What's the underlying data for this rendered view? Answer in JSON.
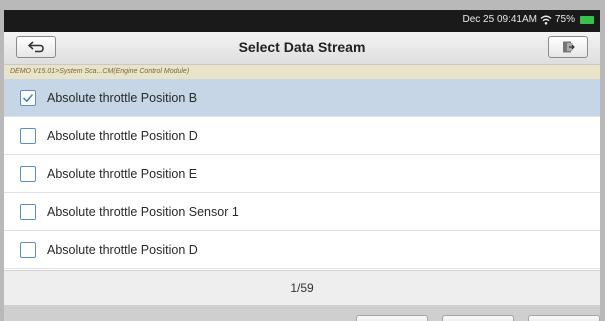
{
  "status_bar": {
    "datetime": "Dec 25 09:41AM",
    "battery": "75%",
    "wifi_icon": "wifi-icon",
    "battery_icon": "battery-icon",
    "battery_color": "#39c24a"
  },
  "header": {
    "title": "Select Data Stream",
    "back_icon": "back-arrow-icon",
    "exit_icon": "exit-door-icon"
  },
  "breadcrumb": "DEMO V15.01>System Sca...CM(Engine Control Module)",
  "items": [
    {
      "label": "Absolute throttle Position B",
      "checked": true
    },
    {
      "label": "Absolute throttle Position D",
      "checked": false
    },
    {
      "label": "Absolute throttle Position E",
      "checked": false
    },
    {
      "label": "Absolute throttle Position Sensor 1",
      "checked": false
    },
    {
      "label": "Absolute throttle Position D",
      "checked": false
    }
  ],
  "pager": {
    "text": "1/59"
  },
  "colors": {
    "selected_row": "#c6d6e6",
    "checkbox_border": "#5a8fc8",
    "breadcrumb_bg": "#e9e3c9"
  }
}
